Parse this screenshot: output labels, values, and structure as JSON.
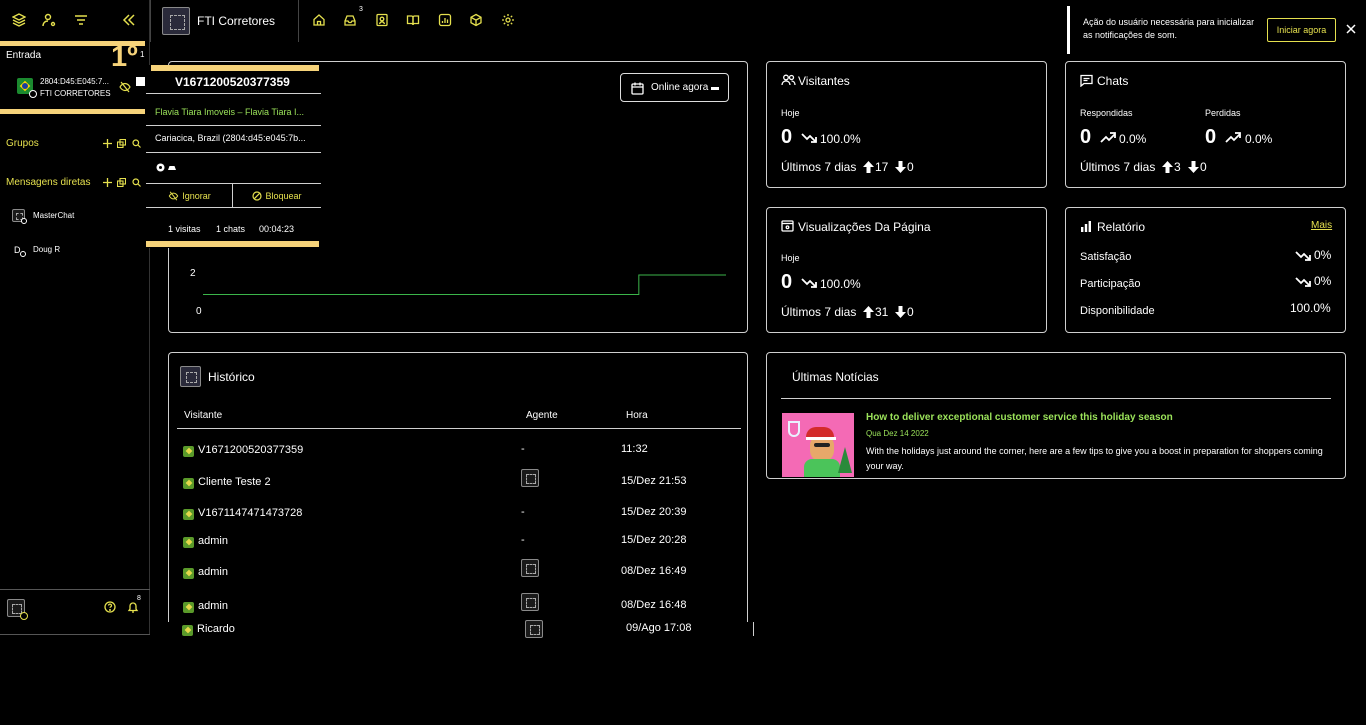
{
  "topbar": {
    "workspace": "FTI Corretores",
    "inbox_badge": "3",
    "notification_text": "Ação do usuário necessária para inicializar as notificações de som.",
    "notification_button": "Iniciar agora"
  },
  "sidebar": {
    "entrada_label": "Entrada",
    "entrada_big": "1º",
    "entrada_small": "1",
    "visitor_ip": "2804:D45:E045:7...",
    "visitor_company": "FTI CORRETORES",
    "grupos_label": "Grupos",
    "mensagens_label": "Mensagens diretas",
    "dm_items": [
      "MasterChat",
      "Doug R"
    ],
    "bell_badge": "8"
  },
  "popup": {
    "visitor_id": "V1671200520377359",
    "page": "Flavia Tiara Imoveis – Flavia Tiara I...",
    "location": "Cariacica, Brazil (2804:d45:e045:7b...",
    "ignore_label": "Ignorar",
    "block_label": "Bloquear",
    "visits": "1 visitas",
    "chats": "1 chats",
    "duration": "00:04:23"
  },
  "online_card": {
    "range_button": "Online agora",
    "y_tick_2": "2",
    "y_tick_0": "0"
  },
  "chart_data": {
    "type": "line",
    "series": [
      {
        "values": [
          1,
          1,
          1,
          1,
          1,
          1,
          1,
          1,
          1,
          1,
          1,
          1,
          1,
          1,
          1,
          1,
          1,
          1,
          1,
          1,
          2,
          2,
          2,
          2,
          2
        ]
      }
    ],
    "yticks": [
      "0",
      "2"
    ],
    "ylim": [
      0,
      4
    ],
    "color": "#3bb54a"
  },
  "visitantes": {
    "title": "Visitantes",
    "today_label": "Hoje",
    "today_value": "0",
    "today_pct": "100.0%",
    "week_label": "Últimos 7 dias",
    "week_up": "17",
    "week_down": "0"
  },
  "chats": {
    "title": "Chats",
    "resp_label": "Respondidas",
    "resp_value": "0",
    "resp_pct": "0.0%",
    "lost_label": "Perdidas",
    "lost_value": "0",
    "lost_pct": "0.0%",
    "week_label": "Últimos 7 dias",
    "week_up": "3",
    "week_down": "0"
  },
  "pageviews": {
    "title": "Visualizações Da Página",
    "today_label": "Hoje",
    "today_value": "0",
    "today_pct": "100.0%",
    "week_label": "Últimos 7 dias",
    "week_up": "31",
    "week_down": "0"
  },
  "relatorio": {
    "title": "Relatório",
    "more": "Mais",
    "rows": [
      {
        "label": "Satisfação",
        "value": "0%"
      },
      {
        "label": "Participação",
        "value": "0%"
      },
      {
        "label": "Disponibilidade",
        "value": "100.0%"
      }
    ]
  },
  "historico": {
    "title": "Histórico",
    "col_visitor": "Visitante",
    "col_agent": "Agente",
    "col_time": "Hora",
    "rows": [
      {
        "visitor": "V1671200520377359",
        "agent": "-",
        "time": "11:32"
      },
      {
        "visitor": "Cliente Teste 2",
        "agent": "",
        "time": "15/Dez 21:53"
      },
      {
        "visitor": "V1671147471473728",
        "agent": "-",
        "time": "15/Dez 20:39"
      },
      {
        "visitor": "admin",
        "agent": "-",
        "time": "15/Dez 20:28"
      },
      {
        "visitor": "admin",
        "agent": "",
        "time": "08/Dez 16:49"
      },
      {
        "visitor": "admin",
        "agent": "",
        "time": "08/Dez 16:48"
      },
      {
        "visitor": "Ricardo",
        "agent": "",
        "time": "09/Ago 17:08"
      }
    ]
  },
  "noticias": {
    "title": "Últimas Notícias",
    "item_title": "How to deliver exceptional customer service this holiday season",
    "item_date": "Qua Dez 14 2022",
    "item_text": "With the holidays just around the corner, here are a few tips to give you a boost in preparation for shoppers coming your way."
  },
  "colors": {
    "accent": "#e5e04e",
    "news_title": "#9be35a",
    "chart_line": "#3bb54a",
    "popup_stripe": "#f6d37a"
  }
}
